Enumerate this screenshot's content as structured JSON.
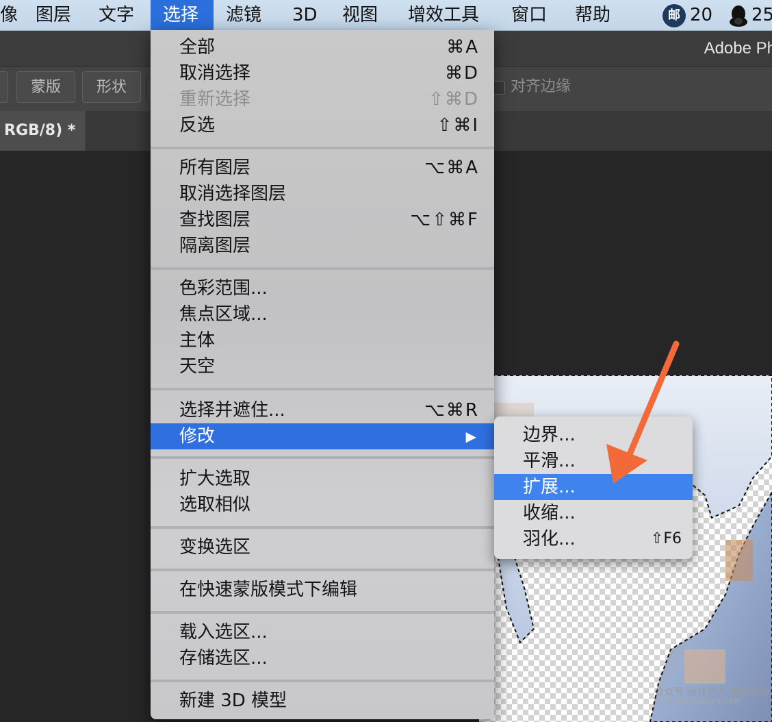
{
  "menubar": {
    "items": [
      "像",
      "图层",
      "文字",
      "选择",
      "滤镜",
      "3D",
      "视图",
      "增效工具",
      "窗口",
      "帮助"
    ],
    "active_item": "选择",
    "mail_badge": "邮",
    "mail_count": "20",
    "qq_count": "25"
  },
  "app": {
    "title": "Adobe Ph",
    "options": {
      "mask_label": "蒙版",
      "shape_label": "形状",
      "align_edges_label": "对齐边缘"
    },
    "document_tab": "RGB/8) *"
  },
  "select_menu": {
    "groups": [
      [
        {
          "label": "全部",
          "shortcut": "⌘A"
        },
        {
          "label": "取消选择",
          "shortcut": "⌘D"
        },
        {
          "label": "重新选择",
          "shortcut": "⇧⌘D",
          "disabled": true
        },
        {
          "label": "反选",
          "shortcut": "⇧⌘I"
        }
      ],
      [
        {
          "label": "所有图层",
          "shortcut": "⌥⌘A"
        },
        {
          "label": "取消选择图层",
          "shortcut": ""
        },
        {
          "label": "查找图层",
          "shortcut": "⌥⇧⌘F"
        },
        {
          "label": "隔离图层",
          "shortcut": ""
        }
      ],
      [
        {
          "label": "色彩范围...",
          "shortcut": ""
        },
        {
          "label": "焦点区域...",
          "shortcut": ""
        },
        {
          "label": "主体",
          "shortcut": ""
        },
        {
          "label": "天空",
          "shortcut": ""
        }
      ],
      [
        {
          "label": "选择并遮住...",
          "shortcut": "⌥⌘R"
        },
        {
          "label": "修改",
          "shortcut": "",
          "submenu": true,
          "highlighted": true
        }
      ],
      [
        {
          "label": "扩大选取",
          "shortcut": ""
        },
        {
          "label": "选取相似",
          "shortcut": ""
        }
      ],
      [
        {
          "label": "变换选区",
          "shortcut": ""
        }
      ],
      [
        {
          "label": "在快速蒙版模式下编辑",
          "shortcut": ""
        }
      ],
      [
        {
          "label": "载入选区...",
          "shortcut": ""
        },
        {
          "label": "存储选区...",
          "shortcut": ""
        }
      ],
      [
        {
          "label": "新建 3D 模型",
          "shortcut": ""
        }
      ]
    ]
  },
  "modify_submenu": {
    "items": [
      {
        "label": "边界...",
        "shortcut": ""
      },
      {
        "label": "平滑...",
        "shortcut": ""
      },
      {
        "label": "扩展...",
        "shortcut": "",
        "highlighted": true
      },
      {
        "label": "收缩...",
        "shortcut": ""
      },
      {
        "label": "羽化...",
        "shortcut": "⇧F6"
      }
    ]
  },
  "watermark": {
    "line1": "公众号·设计达人 整理分享",
    "line2": "WWW.SHEJIDAREN.COM"
  },
  "colors": {
    "highlight": "#2f6fdf",
    "submenu_highlight": "#3e83ee",
    "annotation_arrow": "#f26a3a"
  }
}
